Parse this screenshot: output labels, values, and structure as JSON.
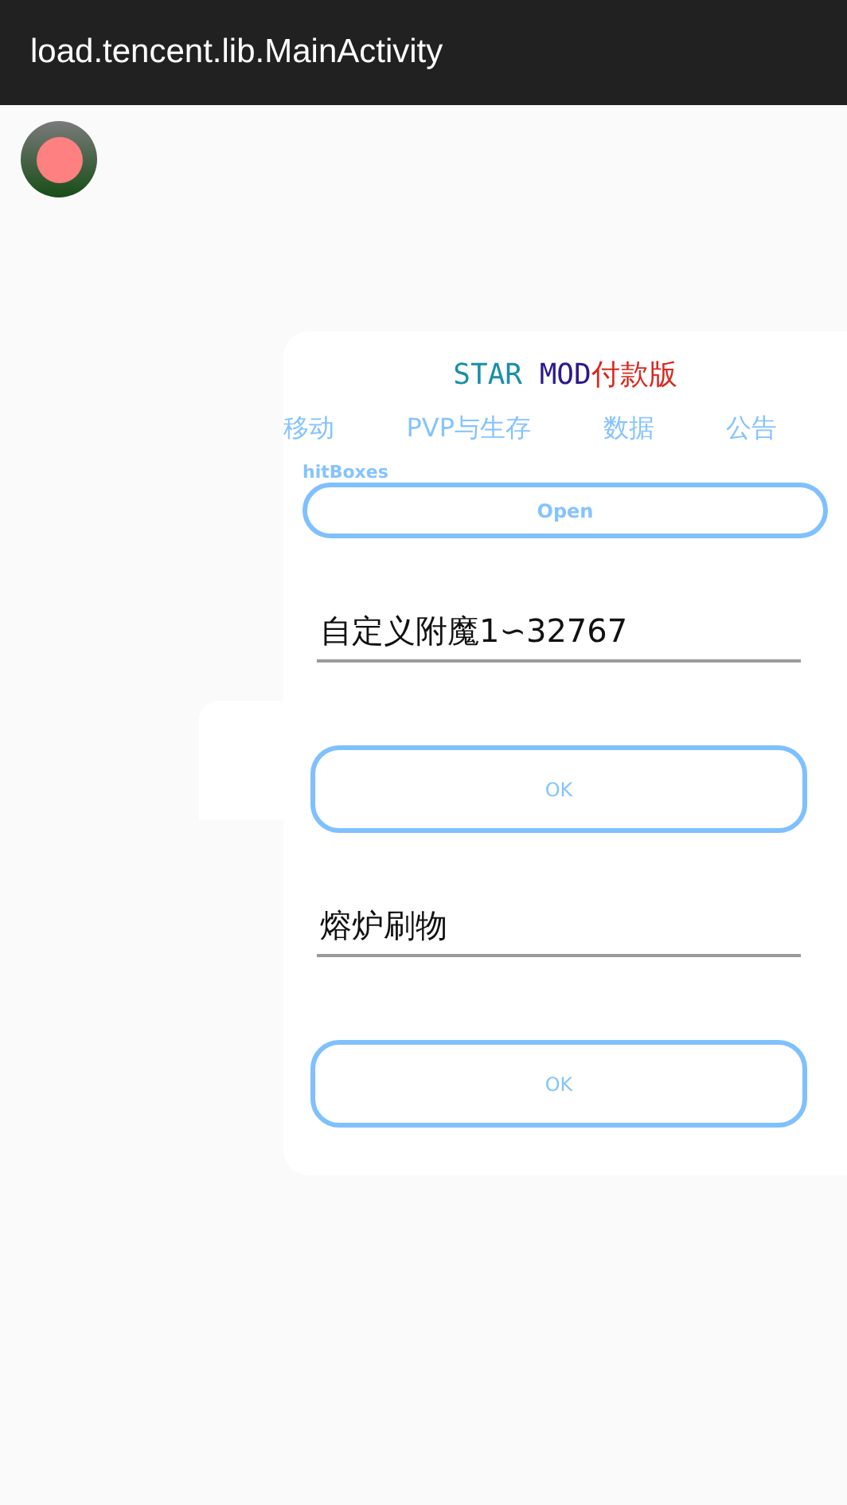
{
  "app_bar": {
    "title": "load.tencent.lib.MainActivity"
  },
  "panel": {
    "title_parts": [
      {
        "text": "STAR ",
        "color": "#1a8fa8"
      },
      {
        "text": "MOD",
        "color": "#2a1a8a"
      },
      {
        "text": "付款版",
        "color": "#d8281e"
      }
    ],
    "tabs": [
      {
        "label": "移动"
      },
      {
        "label": "PVP与生存"
      },
      {
        "label": "数据"
      },
      {
        "label": "公告"
      }
    ],
    "items": [
      {
        "kind": "toggle",
        "label": "hitBoxes",
        "button": "Open"
      },
      {
        "kind": "input",
        "value": "自定义附魔1∽32767",
        "button": "OK"
      },
      {
        "kind": "input",
        "value": "熔炉刷物",
        "button": "OK"
      }
    ]
  }
}
